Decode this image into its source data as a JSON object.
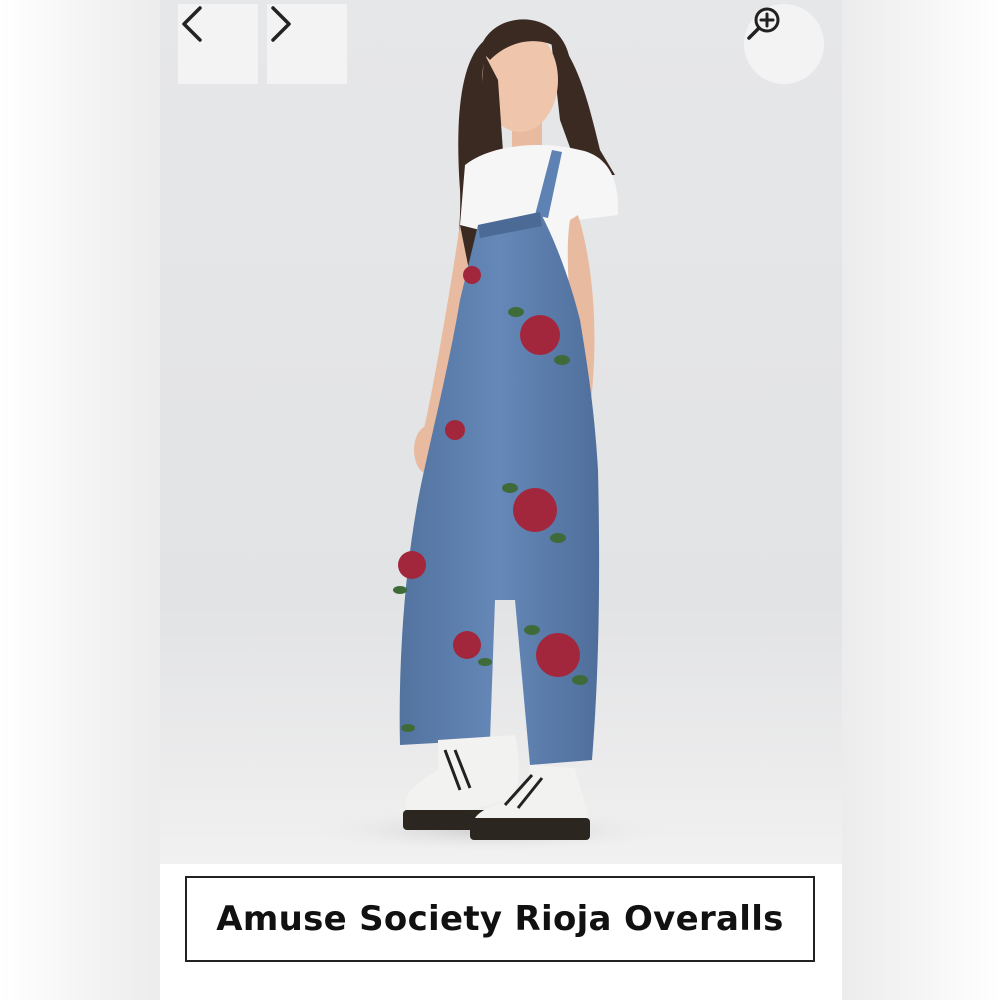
{
  "product": {
    "title": "Amuse Society Rioja Overalls"
  },
  "gallery": {
    "prev_icon": "chevron-left-icon",
    "next_icon": "chevron-right-icon",
    "zoom_icon": "zoom-in-icon"
  },
  "colors": {
    "denim": "#5f82b4",
    "rose": "#a3273c",
    "leaf": "#3f6b3a",
    "background": "#e4e5e7"
  }
}
